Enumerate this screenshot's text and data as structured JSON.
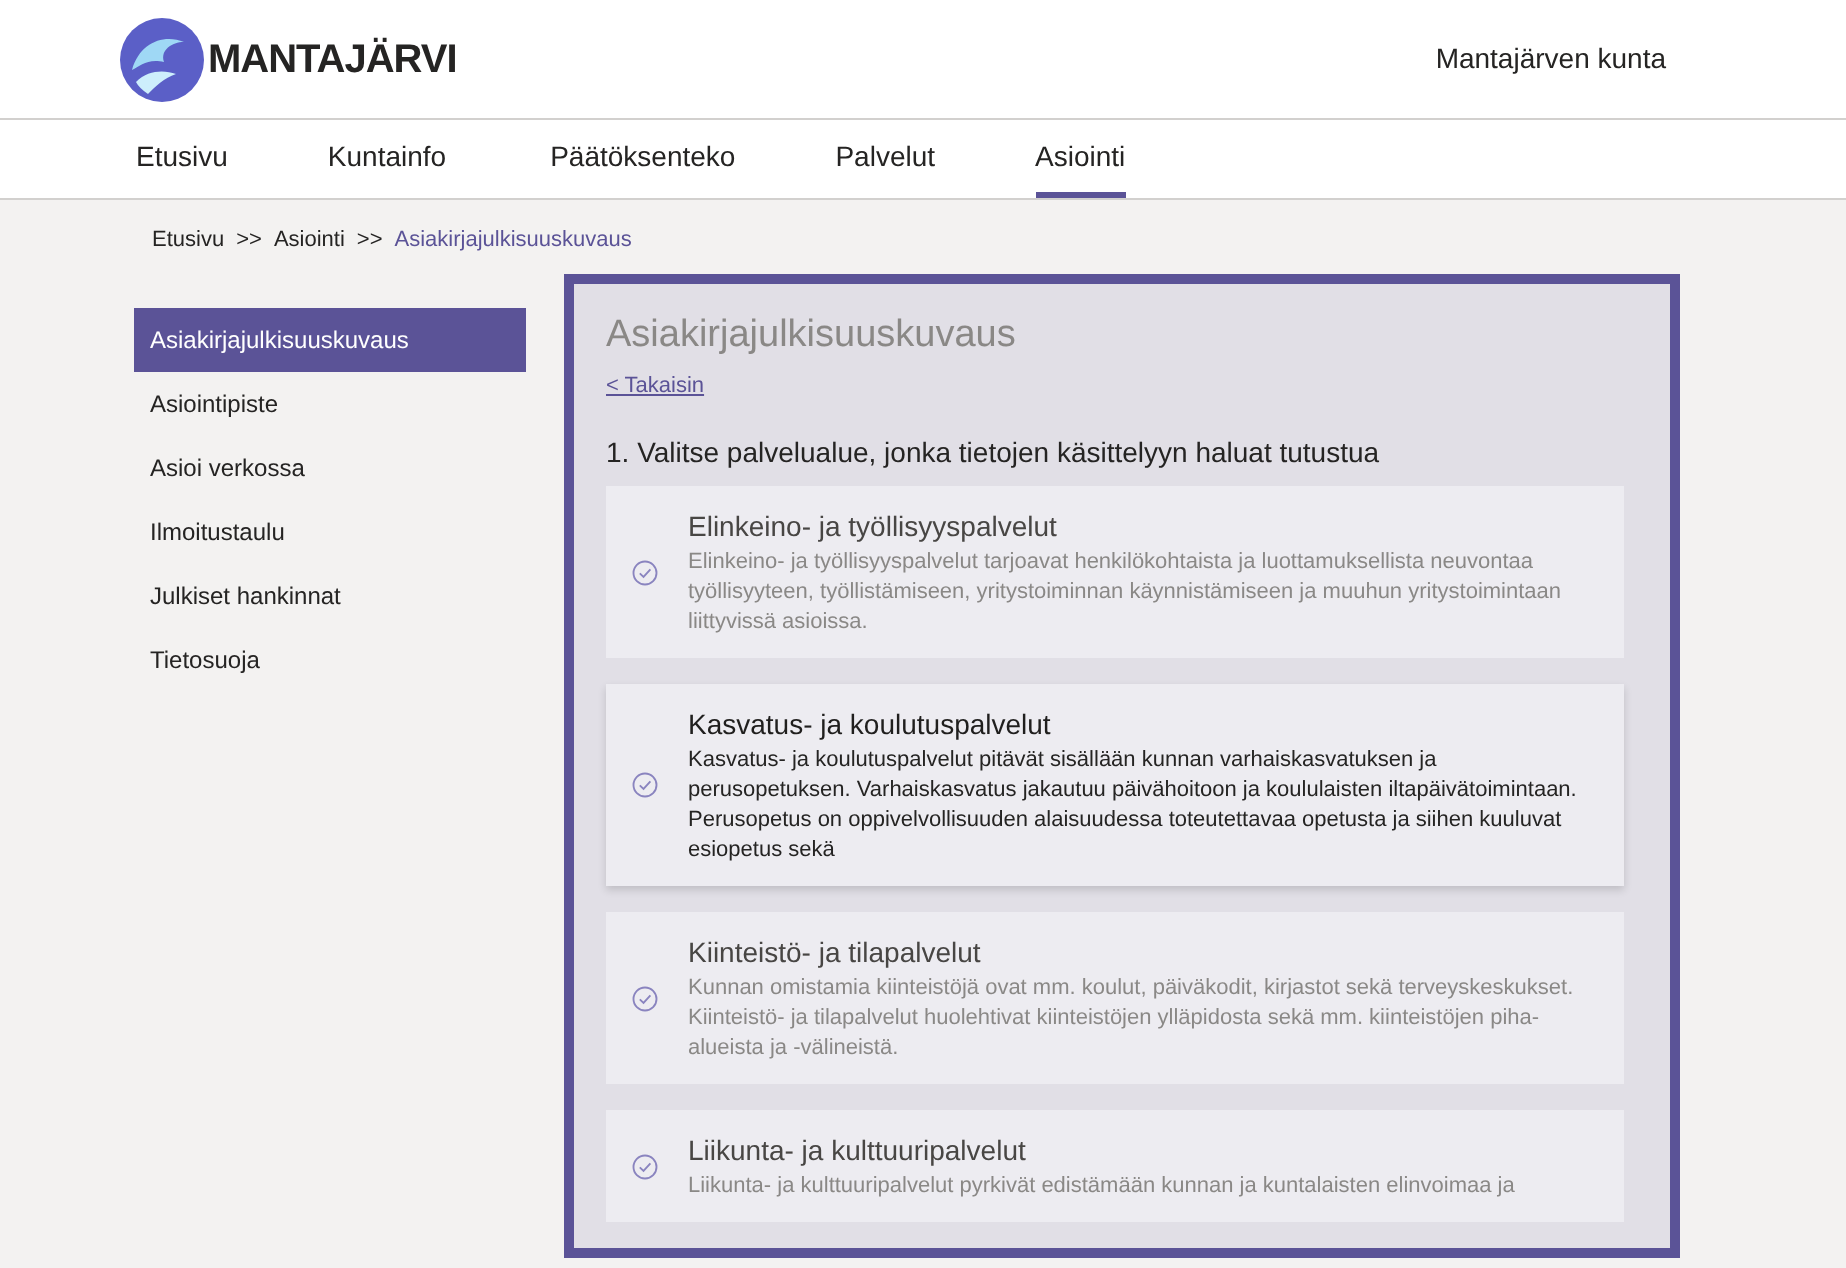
{
  "header": {
    "logo_text": "MANTAJÄRVI",
    "site_name": "Mantajärven kunta"
  },
  "nav": [
    {
      "label": "Etusivu",
      "selected": false
    },
    {
      "label": "Kuntainfo",
      "selected": false
    },
    {
      "label": "Päätöksenteko",
      "selected": false
    },
    {
      "label": "Palvelut",
      "selected": false
    },
    {
      "label": "Asiointi",
      "selected": true
    }
  ],
  "breadcrumb": [
    {
      "label": "Etusivu",
      "current": false
    },
    {
      "label": "Asiointi",
      "current": false
    },
    {
      "label": "Asiakirjajulkisuuskuvaus",
      "current": true
    }
  ],
  "breadcrumb_separator": ">>",
  "sidebar": {
    "items": [
      {
        "label": "Asiakirjajulkisuuskuvaus",
        "selected": true
      },
      {
        "label": "Asiointipiste",
        "selected": false
      },
      {
        "label": "Asioi verkossa",
        "selected": false
      },
      {
        "label": "Ilmoitustaulu",
        "selected": false
      },
      {
        "label": "Julkiset hankinnat",
        "selected": false
      },
      {
        "label": "Tietosuoja",
        "selected": false
      }
    ]
  },
  "panel": {
    "title": "Asiakirjajulkisuuskuvaus",
    "back_link": "< Takaisin",
    "question": "1. Valitse palvelualue, jonka tietojen käsittelyyn haluat tutustua",
    "options": [
      {
        "title": "Elinkeino- ja työllisyyspalvelut",
        "description": "Elinkeino- ja työllisyyspalvelut tarjoavat henkilökohtaista ja luottamuksellista neuvontaa työllisyyteen, työllistämiseen, yritystoiminnan käynnistämiseen ja muuhun yritystoimintaan liittyvissä asioissa.",
        "selected": false
      },
      {
        "title": "Kasvatus- ja koulutuspalvelut",
        "description": "Kasvatus- ja koulutuspalvelut pitävät sisällään kunnan varhaiskasvatuksen ja perusopetuksen. Varhaiskasvatus jakautuu päivähoitoon ja koululaisten iltapäivätoimintaan. Perusopetus on oppivelvollisuuden alaisuudessa toteutettavaa opetusta ja siihen kuuluvat esiopetus sekä",
        "selected": true
      },
      {
        "title": "Kiinteistö- ja tilapalvelut",
        "description": "Kunnan omistamia kiinteistöjä ovat mm. koulut, päiväkodit, kirjastot sekä terveyskeskukset. Kiinteistö- ja tilapalvelut huolehtivat kiinteistöjen ylläpidosta sekä mm. kiinteistöjen piha-alueista ja -välineistä.",
        "selected": false
      },
      {
        "title": "Liikunta- ja kulttuuripalvelut",
        "description": "Liikunta- ja kulttuuripalvelut pyrkivät edistämään kunnan ja kuntalaisten elinvoimaa ja",
        "selected": false
      }
    ]
  }
}
